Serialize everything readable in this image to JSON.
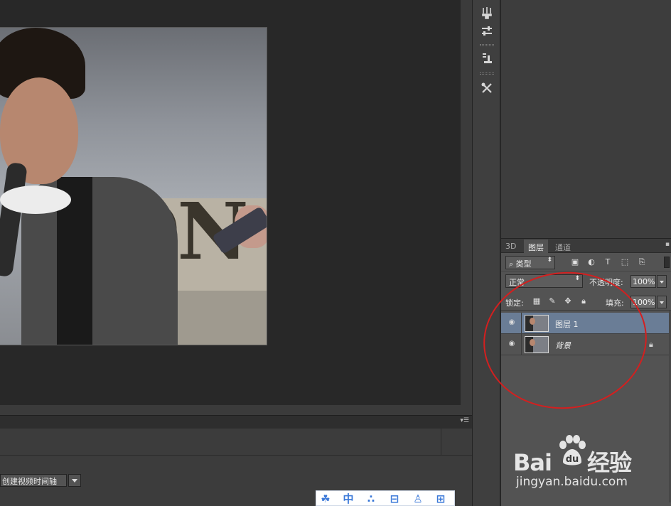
{
  "timeline": {
    "create_button_label": "创建视频时间轴",
    "menu_icon": "panel-menu-icon"
  },
  "tool_strip": {
    "tools": [
      "brush-presets-icon",
      "adjustments-icon",
      "clone-source-icon",
      "tool-presets-icon"
    ]
  },
  "layers_panel": {
    "tabs": [
      {
        "label": "3D",
        "active": false
      },
      {
        "label": "图层",
        "active": true
      },
      {
        "label": "通道",
        "active": false
      }
    ],
    "filter": {
      "icon": "search-icon",
      "kind_label": "类型",
      "icons": [
        "image-filter-icon",
        "adjustment-filter-icon",
        "type-filter-icon",
        "shape-filter-icon",
        "smart-object-filter-icon"
      ]
    },
    "blend_mode": "正常",
    "opacity_label": "不透明度:",
    "opacity_value": "100%",
    "lock_label": "锁定:",
    "fill_label": "填充:",
    "fill_value": "100%",
    "layers": [
      {
        "name": "图层 1",
        "visible": true,
        "selected": true,
        "locked": false
      },
      {
        "name": "背景",
        "visible": true,
        "selected": false,
        "locked": true
      }
    ]
  },
  "watermark": {
    "logo_text": "Bai du 经验",
    "logo_left": "Bai",
    "logo_right": "经验",
    "url": "jingyan.baidu.com"
  },
  "floating_toolbar": {
    "icons": [
      "paw-icon",
      "chinese-input-icon",
      "dots-icon",
      "toolbox-icon",
      "user-icon",
      "grid-icon"
    ]
  },
  "annotation": {
    "color": "#d41f1f"
  },
  "colors": {
    "selected_layer": "#6a7d96",
    "panel_bg": "#535353",
    "canvas_bg": "#282828"
  }
}
